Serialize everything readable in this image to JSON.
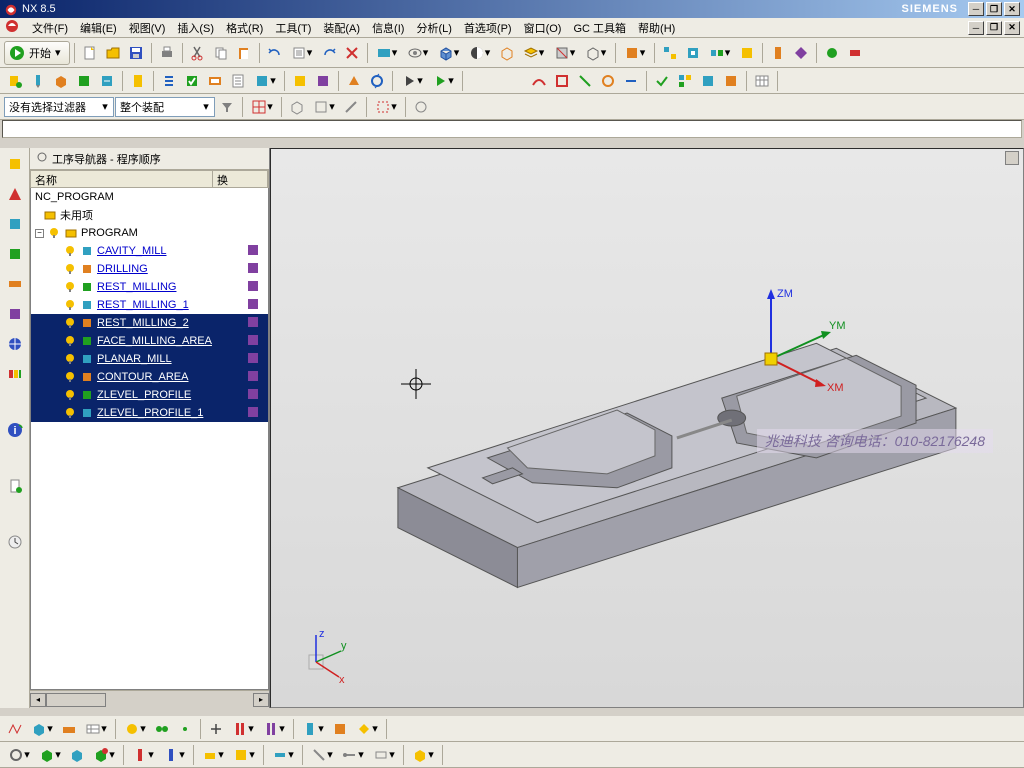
{
  "title": "NX 8.5",
  "brand": "SIEMENS",
  "menu": {
    "file": "文件(F)",
    "edit": "编辑(E)",
    "view": "视图(V)",
    "insert": "插入(S)",
    "format": "格式(R)",
    "tool": "工具(T)",
    "assembly": "装配(A)",
    "info": "信息(I)",
    "analysis": "分析(L)",
    "preferences": "首选项(P)",
    "window": "窗口(O)",
    "gc": "GC 工具箱",
    "help": "帮助(H)"
  },
  "start_label": "开始",
  "filter_label": "没有选择过滤器",
  "scope_label": "整个装配",
  "nav": {
    "title": "工序导航器 - 程序顺序",
    "col_name": "名称",
    "col_change": "换",
    "root": "NC_PROGRAM",
    "unused": "未用项",
    "program": "PROGRAM",
    "ops": [
      {
        "label": "CAVITY_MILL",
        "sel": false
      },
      {
        "label": "DRILLING",
        "sel": false
      },
      {
        "label": "REST_MILLING",
        "sel": false
      },
      {
        "label": "REST_MILLING_1",
        "sel": false
      },
      {
        "label": "REST_MILLING_2",
        "sel": true
      },
      {
        "label": "FACE_MILLING_AREA",
        "sel": true
      },
      {
        "label": "PLANAR_MILL",
        "sel": true
      },
      {
        "label": "CONTOUR_AREA",
        "sel": true
      },
      {
        "label": "ZLEVEL_PROFILE",
        "sel": true
      },
      {
        "label": "ZLEVEL_PROFILE_1",
        "sel": true
      }
    ]
  },
  "axis": {
    "x": "x",
    "y": "y",
    "z": "z",
    "xm": "XM",
    "ym": "YM",
    "zm": "ZM"
  },
  "watermark": "兆迪科技  咨询电话：010-82176248"
}
